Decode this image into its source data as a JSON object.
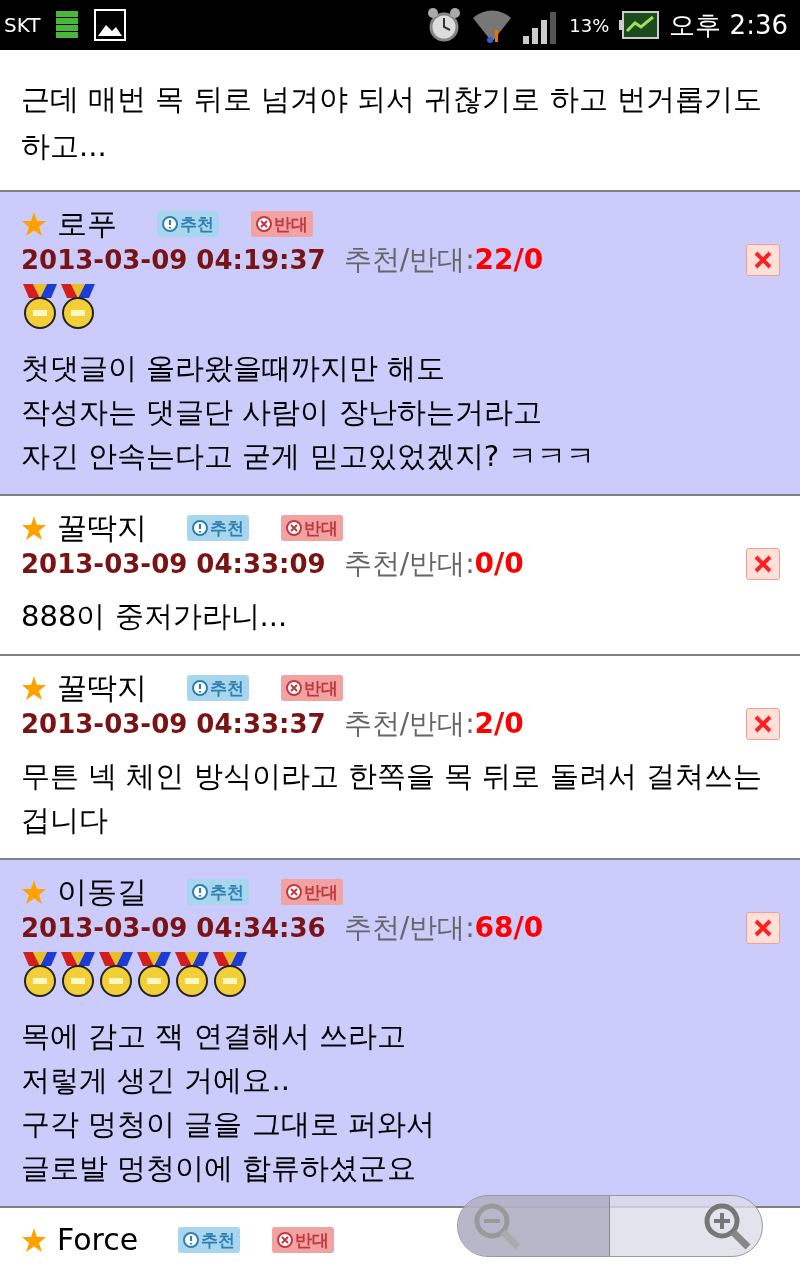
{
  "status_bar": {
    "carrier": "SKT",
    "battery": "13%",
    "time": "오후 2:36"
  },
  "intro_text": "근데 매번 목 뒤로 넘겨야 되서 귀찮기로 하고 번거롭기도 하고...",
  "comments": [
    {
      "author": "로푸",
      "highlighted": true,
      "recommend_label": "추천",
      "oppose_label": "반대",
      "date": "2013-03-09 04:19:37",
      "votes_label": "추천/반대:",
      "votes": "22/0",
      "medals": [
        {
          "kind": "medal"
        },
        {
          "kind": "medal"
        }
      ],
      "lines": [
        "첫댓글이 올라왔을때까지만 해도",
        "작성자는 댓글단 사람이 장난하는거라고",
        "자긴 안속는다고 굳게 믿고있었겠지? ㅋㅋㅋ"
      ]
    },
    {
      "author": "꿀딱지",
      "highlighted": false,
      "recommend_label": "추천",
      "oppose_label": "반대",
      "date": "2013-03-09 04:33:09",
      "votes_label": "추천/반대:",
      "votes": "0/0",
      "lines": [
        "888이 중저가라니..."
      ]
    },
    {
      "author": "꿀딱지",
      "highlighted": false,
      "recommend_label": "추천",
      "oppose_label": "반대",
      "date": "2013-03-09 04:33:37",
      "votes_label": "추천/반대:",
      "votes": "2/0",
      "lines": [
        "무튼 넥 체인 방식이라고 한쪽을 목 뒤로 돌려서 걸쳐쓰는 겁니다"
      ]
    },
    {
      "author": "이동길",
      "highlighted": true,
      "recommend_label": "추천",
      "oppose_label": "반대",
      "date": "2013-03-09 04:34:36",
      "votes_label": "추천/반대:",
      "votes": "68/0",
      "medals": [
        {
          "kind": "medal"
        },
        {
          "kind": "medal"
        },
        {
          "kind": "medal"
        },
        {
          "kind": "medal"
        },
        {
          "kind": "medal"
        },
        {
          "kind": "medal"
        }
      ],
      "lines": [
        "목에 감고 잭 연결해서 쓰라고",
        "저렇게 생긴 거에요..",
        "구각 멍청이 글을 그대로 퍼와서",
        "글로발 멍청이에 합류하셨군요"
      ]
    },
    {
      "author": "Force",
      "highlighted": false,
      "recommend_label": "추천",
      "oppose_label": "반대"
    }
  ]
}
